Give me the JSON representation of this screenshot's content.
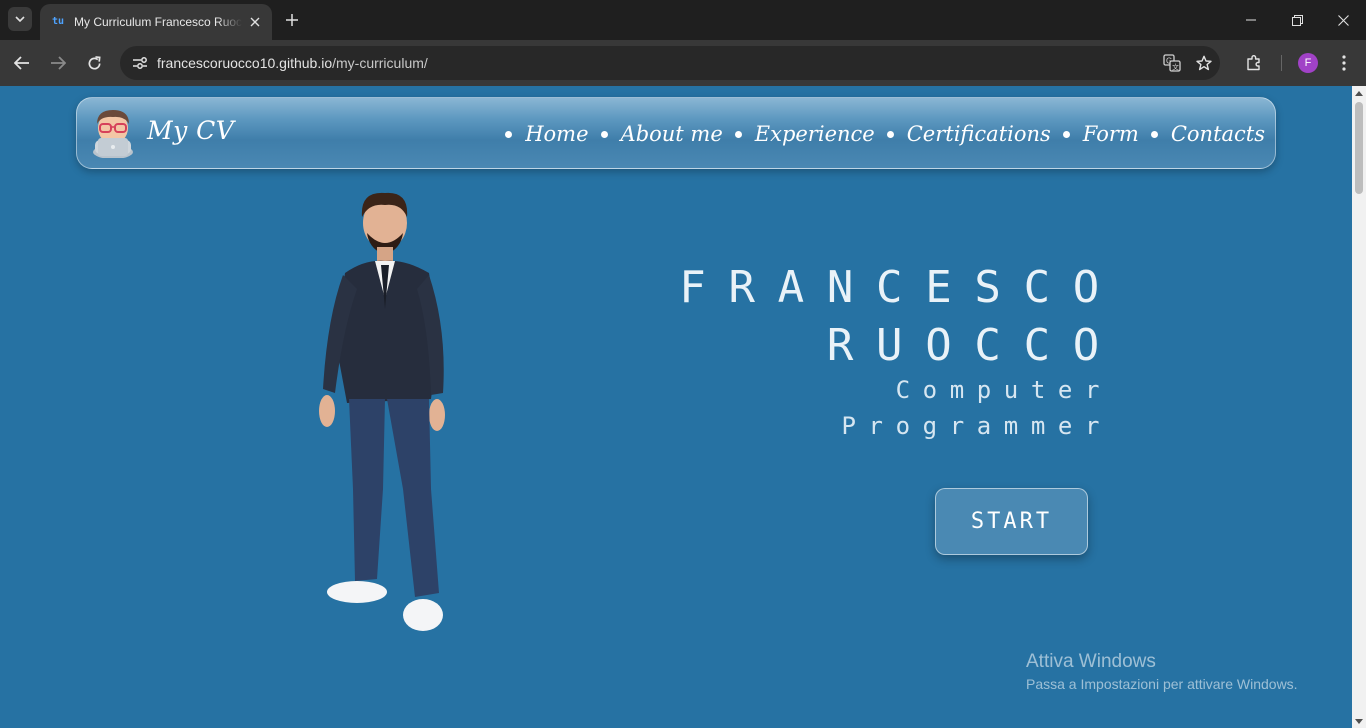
{
  "browser": {
    "tab_title": "My Curriculum Francesco Ruocco",
    "tab_favicon": "tu",
    "url_host": "francescoruocco10.github.io",
    "url_path": "/my-curriculum/",
    "profile_initial": "F",
    "icons": [
      "tab-list-icon",
      "close-icon",
      "plus-icon",
      "minimize-icon",
      "restore-icon",
      "back-arrow-icon",
      "forward-arrow-icon",
      "reload-icon",
      "site-settings-icon",
      "translate-icon",
      "star-icon",
      "extensions-icon",
      "kebab-menu-icon"
    ]
  },
  "navbar": {
    "brand": "My CV",
    "links": [
      "Home",
      "About me",
      "Experience",
      "Certifications",
      "Form",
      "Contacts"
    ]
  },
  "hero": {
    "first_name": "FRANCESCO",
    "last_name": "RUOCCO",
    "role_line1": "Computer",
    "role_line2": "Programmer",
    "start_label": "START"
  },
  "watermark": {
    "title": "Attiva Windows",
    "subtitle": "Passa a Impostazioni per attivare Windows."
  },
  "colors": {
    "page_bg": "#2672a3",
    "chrome_bg": "#1f1f1f",
    "toolbar_bg": "#383838",
    "button_bg": "#4a89b3"
  }
}
